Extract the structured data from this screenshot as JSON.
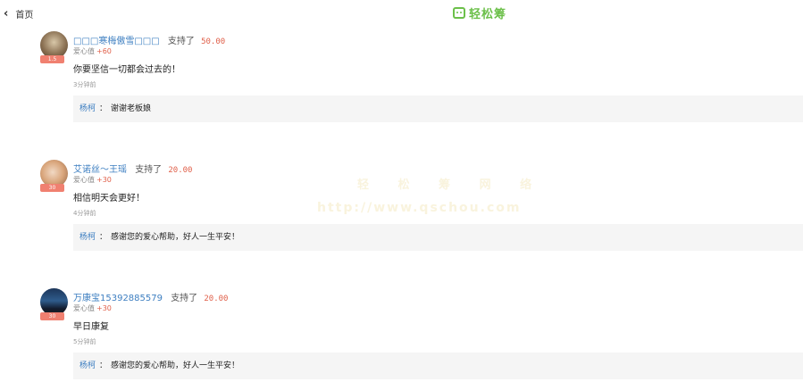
{
  "header": {
    "back_label": "首页",
    "back_icon": "chevron-left-icon",
    "logo_text": "轻松筹",
    "logo_color": "#6cc04a"
  },
  "watermark": {
    "line1": "轻 松 筹 网 络",
    "line2": "http://www.qschou.com"
  },
  "comments": [
    {
      "name": "□□□寒梅傲雪□□□",
      "support_label": "支持了",
      "amount": "50.00",
      "badge": "1.5",
      "love_label": "爱心值",
      "love_value": "+60",
      "message": "你要坚信一切都会过去的！",
      "time": "3分钟前",
      "reply": {
        "name": "杨柯",
        "sep": "：",
        "text": "谢谢老板娘"
      }
    },
    {
      "name": "艾诺丝～王瑶",
      "support_label": "支持了",
      "amount": "20.00",
      "badge": "30",
      "love_label": "爱心值",
      "love_value": "+30",
      "message": "相信明天会更好！",
      "time": "4分钟前",
      "reply": {
        "name": "杨柯",
        "sep": "：",
        "text": "感谢您的爱心帮助，好人一生平安！"
      }
    },
    {
      "name": "万康宝15392885579",
      "support_label": "支持了",
      "amount": "20.00",
      "badge": "30",
      "love_label": "爱心值",
      "love_value": "+30",
      "message": "早日康复",
      "time": "5分钟前",
      "reply": {
        "name": "杨柯",
        "sep": "：",
        "text": "感谢您的爱心帮助，好人一生平安！"
      }
    }
  ],
  "colors": {
    "name": "#3e7fc1",
    "amount": "#e0604a",
    "reply_bg": "#f5f5f5"
  }
}
